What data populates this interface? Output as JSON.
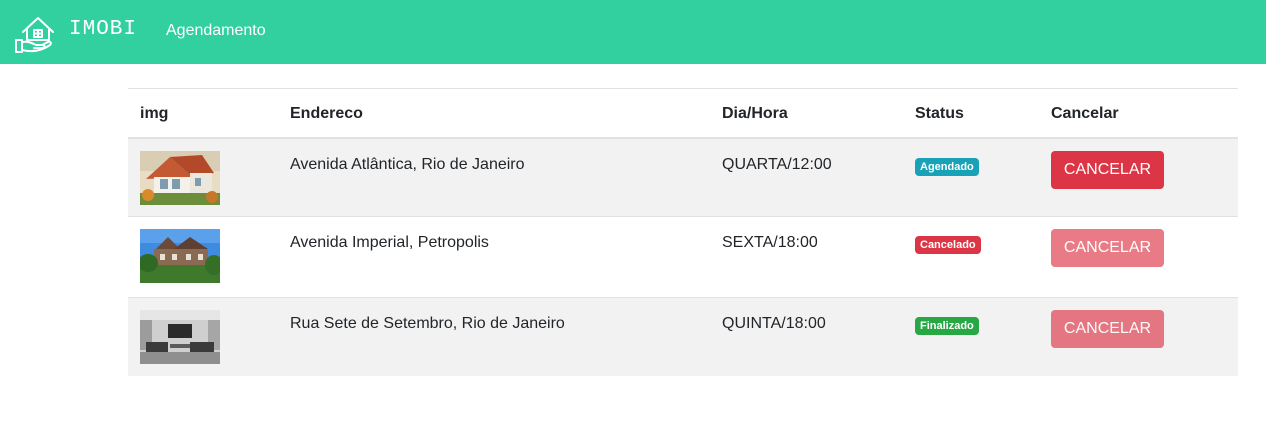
{
  "navbar": {
    "brand": "IMOBI",
    "link": "Agendamento",
    "logo_icon": "house-in-hand-icon",
    "bg_color": "#31d09e"
  },
  "table": {
    "headers": [
      "img",
      "Endereco",
      "Dia/Hora",
      "Status",
      "Cancelar"
    ],
    "rows": [
      {
        "image": "house-photo-chalet",
        "endereco": "Avenida Atlântica, Rio de Janeiro",
        "dia_hora": "QUARTA/12:00",
        "status": "Agendado",
        "status_color": "#17a2b8",
        "button": "CANCELAR",
        "button_enabled": true
      },
      {
        "image": "house-photo-cottage",
        "endereco": "Avenida Imperial, Petropolis",
        "dia_hora": "SEXTA/18:00",
        "status": "Cancelado",
        "status_color": "#dc3545",
        "button": "CANCELAR",
        "button_enabled": false
      },
      {
        "image": "house-photo-interior",
        "endereco": "Rua Sete de Setembro, Rio de Janeiro",
        "dia_hora": "QUINTA/18:00",
        "status": "Finalizado",
        "status_color": "#28a745",
        "button": "CANCELAR",
        "button_enabled": false
      }
    ]
  }
}
